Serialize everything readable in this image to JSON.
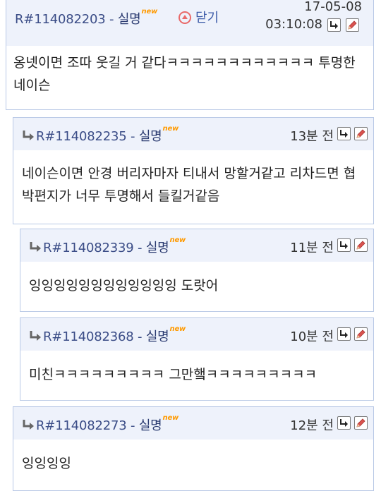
{
  "comments": [
    {
      "id": "R#114082203",
      "author": "실명",
      "badge": "new",
      "close_label": "닫기",
      "date": "17-05-08",
      "time": "03:10:08",
      "text": "옹넷이면 조따 웃길 거 같다ㅋㅋㅋㅋㅋㅋㅋㅋㅋㅋㅋㅋ 투명한 네이슨"
    },
    {
      "id": "R#114082235",
      "author": "실명",
      "badge": "new",
      "time": "13분 전",
      "text": "네이슨이면 안경 버리자마자 티내서 망할거같고 리차드면 협박편지가 너무 투명해서 들킬거같음"
    },
    {
      "id": "R#114082339",
      "author": "실명",
      "badge": "new",
      "time": "11분 전",
      "text": "잉잉잉잉잉잉잉잉잉잉잉잉 도랏어"
    },
    {
      "id": "R#114082368",
      "author": "실명",
      "badge": "new",
      "time": "10분 전",
      "text": "미친ㅋㅋㅋㅋㅋㅋㅋㅋㅋ 그만햌ㅋㅋㅋㅋㅋㅋㅋㅋㅋ"
    },
    {
      "id": "R#114082273",
      "author": "실명",
      "badge": "new",
      "time": "12분 전",
      "text": "잉잉잉잉"
    }
  ],
  "icons": {
    "reply": "reply-arrow-icon",
    "edit": "pencil-icon",
    "close": "up-arrow-circle-icon",
    "nested": "nested-reply-arrow-icon"
  },
  "colors": {
    "header_bg": "#eef2fb",
    "border": "#b9c9e6",
    "id_text": "#3b4d87",
    "badge": "#ff9a00",
    "close_circle": "#e96a6a"
  }
}
